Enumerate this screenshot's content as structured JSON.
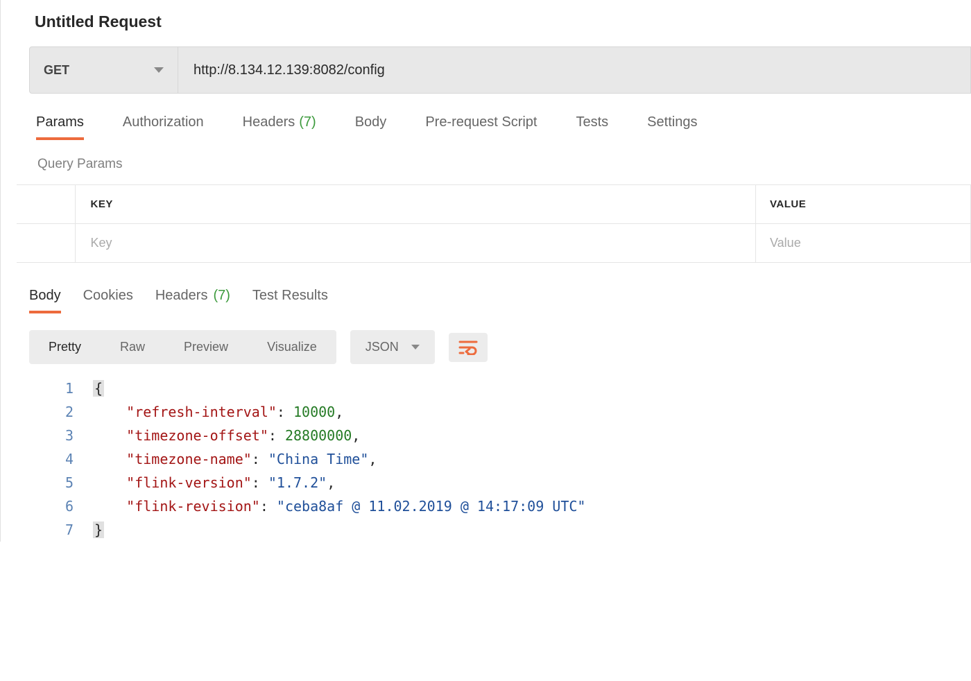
{
  "title": "Untitled Request",
  "request": {
    "method": "GET",
    "url": "http://8.134.12.139:8082/config"
  },
  "req_tabs": {
    "params": "Params",
    "authorization": "Authorization",
    "headers_label": "Headers",
    "headers_count": "(7)",
    "body": "Body",
    "prerequest": "Pre-request Script",
    "tests": "Tests",
    "settings": "Settings"
  },
  "query_params": {
    "title": "Query Params",
    "col_key": "KEY",
    "col_value": "VALUE",
    "key_placeholder": "Key",
    "value_placeholder": "Value"
  },
  "resp_tabs": {
    "body": "Body",
    "cookies": "Cookies",
    "headers_label": "Headers",
    "headers_count": "(7)",
    "test_results": "Test Results"
  },
  "view": {
    "pretty": "Pretty",
    "raw": "Raw",
    "preview": "Preview",
    "visualize": "Visualize",
    "format": "JSON"
  },
  "json": {
    "k1": "\"refresh-interval\"",
    "v1": "10000",
    "k2": "\"timezone-offset\"",
    "v2": "28800000",
    "k3": "\"timezone-name\"",
    "v3": "\"China Time\"",
    "k4": "\"flink-version\"",
    "v4": "\"1.7.2\"",
    "k5": "\"flink-revision\"",
    "v5": "\"ceba8af @ 11.02.2019 @ 14:17:09 UTC\"",
    "open": "{",
    "close": "}",
    "colon": ":",
    "comma": ","
  },
  "line_numbers": [
    "1",
    "2",
    "3",
    "4",
    "5",
    "6",
    "7"
  ]
}
